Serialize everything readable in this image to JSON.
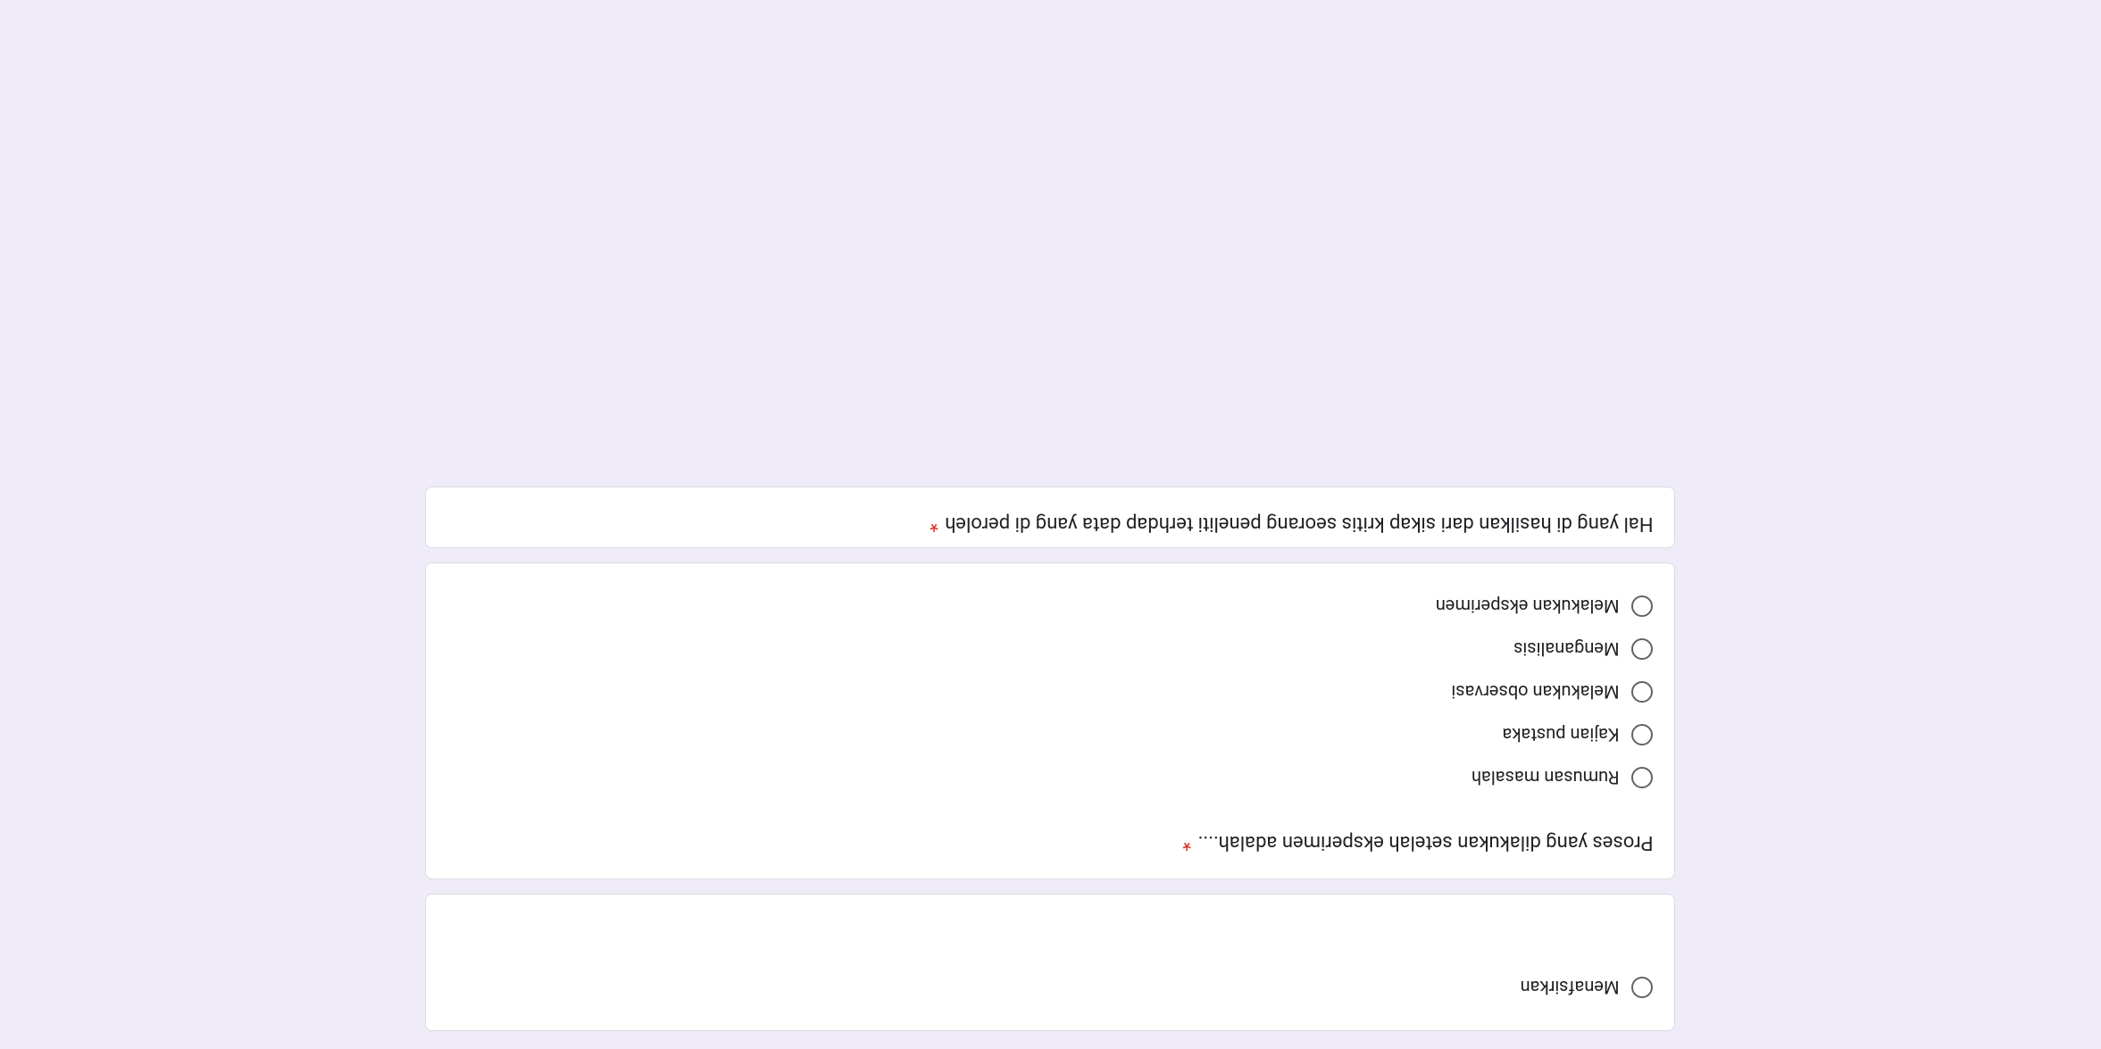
{
  "prev_question": {
    "last_option": "Menafsirkan"
  },
  "question1": {
    "text": "Proses yang dilakukan setelah eksperimen adalah....",
    "required": "*",
    "options": [
      "Rumusan masalah",
      "Kajian pustaka",
      "Melakukan observasi",
      "Menganalisis",
      "Melakukan eksperimen"
    ]
  },
  "question2": {
    "text": "Hal yang di hasilkan dari sikap kritis seorang peneliti terhdap data yang di peroleh",
    "required": "*"
  }
}
